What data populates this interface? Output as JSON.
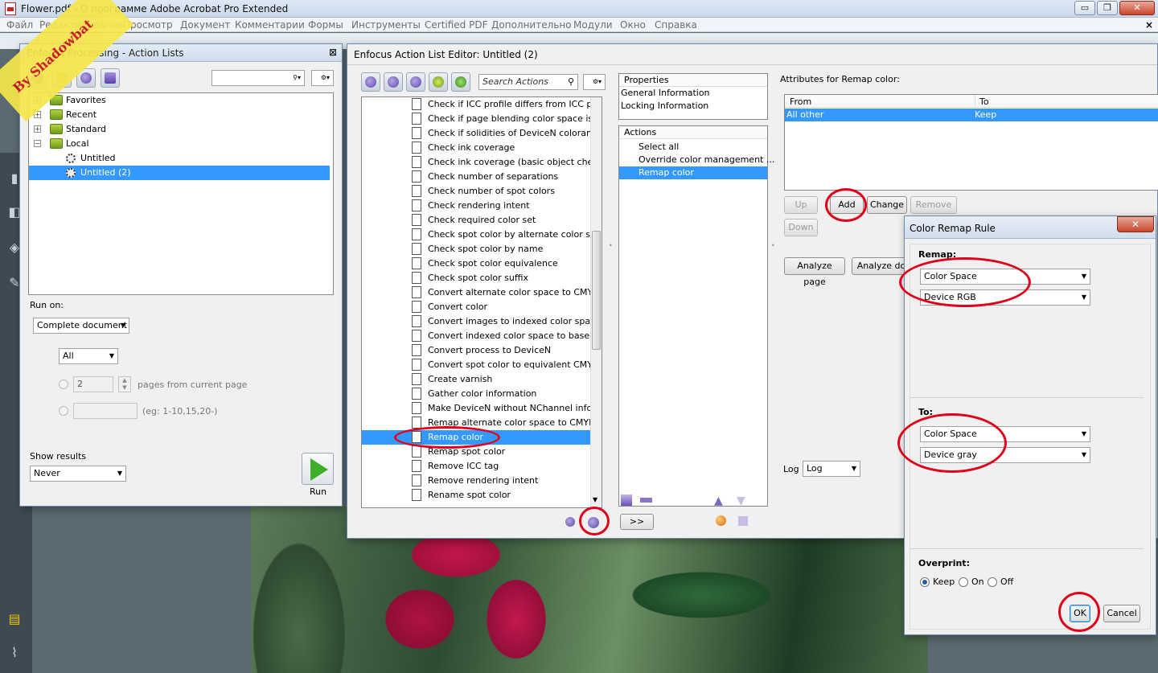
{
  "acrobat": {
    "title": "Flower.pdf - О программе Adobe Acrobat Pro Extended",
    "min_label": "▭",
    "max_label": "❐",
    "close_label": "✕",
    "menu": [
      "Файл",
      "Редактирование",
      "Просмотр",
      "Документ",
      "Комментарии",
      "Формы",
      "Инструменты",
      "Certified PDF",
      "Дополнительно",
      "Модули",
      "Окно",
      "Справка"
    ],
    "menu_close": "×"
  },
  "watermark": "By Shadowbat",
  "action_lists": {
    "title": "Enfocus Processing - Action Lists",
    "close_label": "⊠",
    "tree": [
      {
        "label": "Favorites",
        "expander": "+"
      },
      {
        "label": "Recent",
        "expander": "+"
      },
      {
        "label": "Standard",
        "expander": "+"
      },
      {
        "label": "Local",
        "expander": "−"
      },
      {
        "label": "Untitled"
      },
      {
        "label": "Untitled (2)"
      }
    ],
    "run_on_label": "Run on:",
    "run_on_value": "Complete document",
    "pages_value": "All",
    "pages_count": "2",
    "pages_from_label": "pages from current page",
    "range_hint": "(eg: 1-10,15,20-)",
    "show_results_label": "Show results",
    "show_results_value": "Never",
    "run_label": "Run"
  },
  "editor": {
    "title": "Enfocus Action List Editor: Untitled (2)",
    "search_placeholder": "Search Actions",
    "actions": [
      "Check if ICC profile differs from ICC profil...",
      "Check if page blending color space is de...",
      "Check if solidities of DeviceN colorants ...",
      "Check ink coverage",
      "Check ink coverage (basic object check)",
      "Check number of separations",
      "Check number of spot colors",
      "Check rendering intent",
      "Check required color set",
      "Check spot color by alternate color space",
      "Check spot color by name",
      "Check spot color equivalence",
      "Check spot color suffix",
      "Convert alternate color space to CMYK",
      "Convert color",
      "Convert images to indexed color space",
      "Convert indexed color space to base col...",
      "Convert process to DeviceN",
      "Convert spot color to equivalent CMYK c...",
      "Create varnish",
      "Gather color information",
      "Make DeviceN without NChannel inform...",
      "Remap alternate color space to CMYK",
      "Remap color",
      "Remap spot color",
      "Remove ICC tag",
      "Remove rendering intent",
      "Rename spot color"
    ],
    "properties_header": "Properties",
    "properties": [
      "General Information",
      "Locking Information"
    ],
    "actions_header": "Actions",
    "list_actions": [
      "Select all",
      "Override color management ...",
      "Remap color"
    ],
    "more_label": ">>",
    "attributes_title": "Attributes for Remap color:",
    "table_headers": {
      "from": "From",
      "to": "To"
    },
    "table_rows": [
      {
        "from": "All other",
        "to": "Keep"
      }
    ],
    "btn_up": "Up",
    "btn_add": "Add",
    "btn_change": "Change",
    "btn_remove": "Remove",
    "btn_down": "Down",
    "btn_analyze_page": "Analyze page",
    "btn_analyze_doc": "Analyze doc",
    "log_label": "Log",
    "log_value": "Log"
  },
  "remap_dialog": {
    "title": "Color Remap Rule",
    "close_label": "✕",
    "remap_label": "Remap:",
    "remap_type": "Color Space",
    "remap_value": "Device RGB",
    "to_label": "To:",
    "to_type": "Color Space",
    "to_value": "Device gray",
    "overprint_label": "Overprint:",
    "op_keep": "Keep",
    "op_on": "On",
    "op_off": "Off",
    "ok_label": "OK",
    "cancel_label": "Cancel"
  }
}
